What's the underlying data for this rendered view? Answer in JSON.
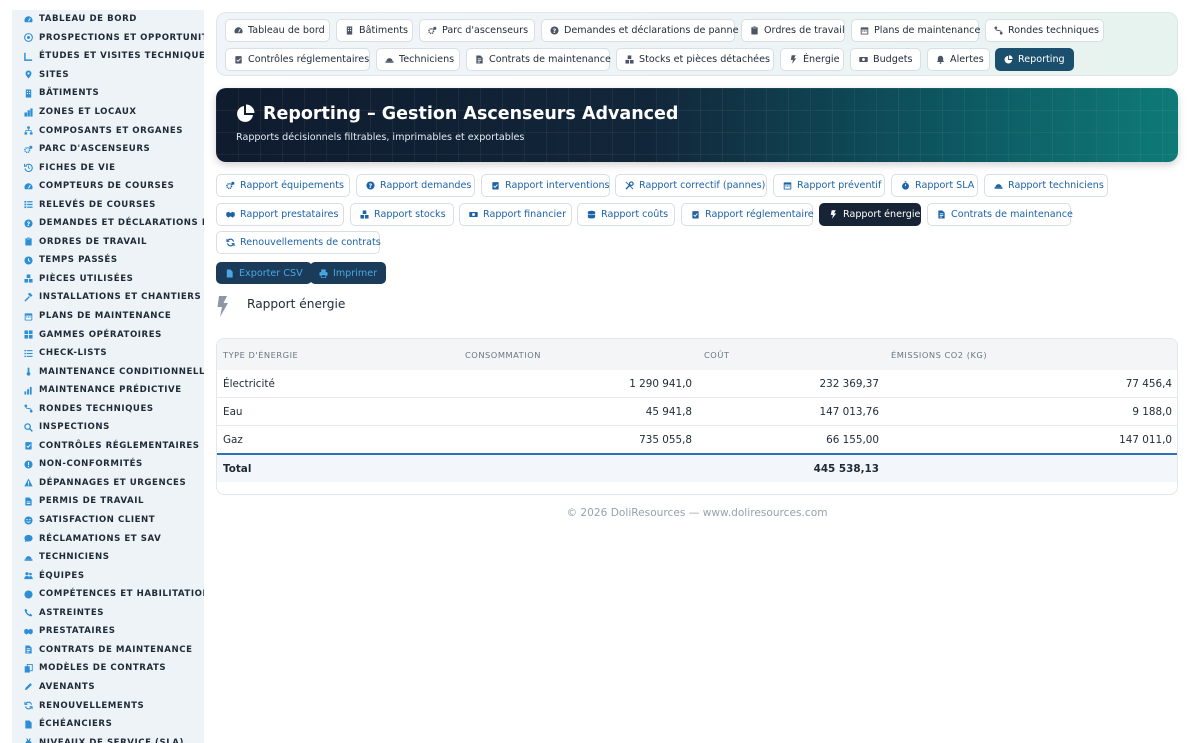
{
  "sidebar": {
    "items": [
      {
        "label": "TABLEAU DE BORD",
        "icon": "gauge-icon"
      },
      {
        "label": "PROSPECTIONS ET OPPORTUNITÉS",
        "icon": "target-icon"
      },
      {
        "label": "ÉTUDES ET VISITES TECHNIQUES",
        "icon": "ruler-icon"
      },
      {
        "label": "SITES",
        "icon": "pin-icon"
      },
      {
        "label": "BÂTIMENTS",
        "icon": "building-icon"
      },
      {
        "label": "ZONES ET LOCAUX",
        "icon": "zones-icon"
      },
      {
        "label": "COMPOSANTS ET ORGANES",
        "icon": "tree-icon"
      },
      {
        "label": "PARC D'ASCENSEURS",
        "icon": "gears-icon"
      },
      {
        "label": "FICHES DE VIE",
        "icon": "history-icon"
      },
      {
        "label": "COMPTEURS DE COURSES",
        "icon": "gauge-icon"
      },
      {
        "label": "RELEVÉS DE COURSES",
        "icon": "list-icon"
      },
      {
        "label": "DEMANDES ET DÉCLARATIONS DE PANNE",
        "icon": "question-icon"
      },
      {
        "label": "ORDRES DE TRAVAIL",
        "icon": "clipboard-icon"
      },
      {
        "label": "TEMPS PASSÉS",
        "icon": "clock-icon"
      },
      {
        "label": "PIÈCES UTILISÉES",
        "icon": "boxes-icon"
      },
      {
        "label": "INSTALLATIONS ET CHANTIERS",
        "icon": "hammer-icon"
      },
      {
        "label": "PLANS DE MAINTENANCE",
        "icon": "calendar-icon"
      },
      {
        "label": "GAMMES OPÉRATOIRES",
        "icon": "grid-icon"
      },
      {
        "label": "CHECK-LISTS",
        "icon": "checklist-icon"
      },
      {
        "label": "MAINTENANCE CONDITIONNELLE",
        "icon": "thermometer-icon"
      },
      {
        "label": "MAINTENANCE PRÉDICTIVE",
        "icon": "chart-icon"
      },
      {
        "label": "RONDES TECHNIQUES",
        "icon": "route-icon"
      },
      {
        "label": "INSPECTIONS",
        "icon": "search-icon"
      },
      {
        "label": "CONTRÔLES RÉGLEMENTAIRES",
        "icon": "clipboard-check-icon"
      },
      {
        "label": "NON-CONFORMITÉS",
        "icon": "alert-circle-icon"
      },
      {
        "label": "DÉPANNAGES ET URGENCES",
        "icon": "warning-icon"
      },
      {
        "label": "PERMIS DE TRAVAIL",
        "icon": "document-icon"
      },
      {
        "label": "SATISFACTION CLIENT",
        "icon": "smile-icon"
      },
      {
        "label": "RÉCLAMATIONS ET SAV",
        "icon": "chat-icon"
      },
      {
        "label": "TECHNICIENS",
        "icon": "hardhat-icon"
      },
      {
        "label": "ÉQUIPES",
        "icon": "users-icon"
      },
      {
        "label": "COMPÉTENCES ET HABILITATIONS",
        "icon": "certificate-icon"
      },
      {
        "label": "ASTREINTES",
        "icon": "phone-icon"
      },
      {
        "label": "PRESTATAIRES",
        "icon": "handshake-icon"
      },
      {
        "label": "CONTRATS DE MAINTENANCE",
        "icon": "contract-icon"
      },
      {
        "label": "MODÈLES DE CONTRATS",
        "icon": "copy-icon"
      },
      {
        "label": "AVENANTS",
        "icon": "edit-icon"
      },
      {
        "label": "RENOUVELLEMENTS",
        "icon": "refresh-icon"
      },
      {
        "label": "ÉCHÉANCIERS",
        "icon": "file-icon"
      },
      {
        "label": "NIVEAUX DE SERVICE (SLA)",
        "icon": "medal-icon"
      }
    ]
  },
  "topmenu": {
    "items": [
      {
        "label": "Tableau de bord",
        "icon": "gauge-icon"
      },
      {
        "label": "Bâtiments",
        "icon": "building-icon"
      },
      {
        "label": "Parc d'ascenseurs",
        "icon": "gears-icon"
      },
      {
        "label": "Demandes et déclarations de panne",
        "icon": "question-icon"
      },
      {
        "label": "Ordres de travail",
        "icon": "clipboard-icon"
      },
      {
        "label": "Plans de maintenance",
        "icon": "calendar-icon"
      },
      {
        "label": "Rondes techniques",
        "icon": "route-icon"
      },
      {
        "label": "Contrôles réglementaires",
        "icon": "clipboard-check-icon"
      },
      {
        "label": "Techniciens",
        "icon": "hardhat-icon"
      },
      {
        "label": "Contrats de maintenance",
        "icon": "contract-icon"
      },
      {
        "label": "Stocks et pièces détachées",
        "icon": "boxes-icon"
      },
      {
        "label": "Énergie",
        "icon": "bolt-icon"
      },
      {
        "label": "Budgets",
        "icon": "money-icon"
      },
      {
        "label": "Alertes",
        "icon": "bell-icon"
      },
      {
        "label": "Reporting",
        "icon": "pie-icon",
        "active": true
      }
    ]
  },
  "banner": {
    "title": "Reporting – Gestion Ascenseurs Advanced",
    "subtitle": "Rapports décisionnels filtrables, imprimables et exportables"
  },
  "reports": {
    "items": [
      {
        "label": "Rapport équipements",
        "icon": "gears-icon"
      },
      {
        "label": "Rapport demandes",
        "icon": "question-icon"
      },
      {
        "label": "Rapport interventions",
        "icon": "clipboard-check-icon"
      },
      {
        "label": "Rapport correctif (pannes)",
        "icon": "tools-icon"
      },
      {
        "label": "Rapport préventif",
        "icon": "calendar-icon"
      },
      {
        "label": "Rapport SLA",
        "icon": "stopwatch-icon"
      },
      {
        "label": "Rapport techniciens",
        "icon": "hardhat-icon"
      },
      {
        "label": "Rapport prestataires",
        "icon": "handshake-icon"
      },
      {
        "label": "Rapport stocks",
        "icon": "boxes-icon"
      },
      {
        "label": "Rapport financier",
        "icon": "money-icon"
      },
      {
        "label": "Rapport coûts",
        "icon": "coins-icon"
      },
      {
        "label": "Rapport réglementaire",
        "icon": "clipboard-check-icon"
      },
      {
        "label": "Rapport énergie",
        "icon": "bolt-icon",
        "active": true
      },
      {
        "label": "Contrats de maintenance",
        "icon": "contract-icon"
      },
      {
        "label": "Renouvellements de contrats",
        "icon": "refresh-icon"
      }
    ]
  },
  "actions": {
    "export_label": "Exporter CSV",
    "print_label": "Imprimer"
  },
  "section": {
    "title": "Rapport énergie"
  },
  "table": {
    "headers": [
      "Type d'énergie",
      "Consommation",
      "Coût",
      "Émissions CO2 (kg)"
    ],
    "rows": [
      {
        "type": "Électricité",
        "consumption": "1 290 941,0",
        "cost": "232 369,37",
        "co2": "77 456,4"
      },
      {
        "type": "Eau",
        "consumption": "45 941,8",
        "cost": "147 013,76",
        "co2": "9 188,0"
      },
      {
        "type": "Gaz",
        "consumption": "735 055,8",
        "cost": "66 155,00",
        "co2": "147 011,0"
      }
    ],
    "total_label": "Total",
    "total_cost": "445 538,13"
  },
  "footer": {
    "text": "© 2026 DoliResources — www.doliresources.com"
  },
  "colors": {
    "accent": "#1d63a8",
    "active_tab": "#1b4f6e",
    "active_report": "#162435",
    "icon": "#2c8fd6"
  }
}
